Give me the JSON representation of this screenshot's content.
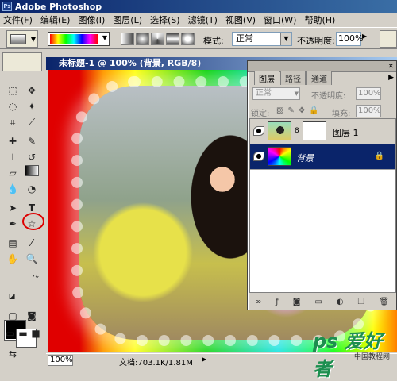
{
  "app": {
    "title": "Adobe Photoshop",
    "logo": "Ps"
  },
  "menu": [
    "文件(F)",
    "编辑(E)",
    "图像(I)",
    "图层(L)",
    "选择(S)",
    "滤镜(T)",
    "视图(V)",
    "窗口(W)",
    "帮助(H)"
  ],
  "options": {
    "mode_label": "模式:",
    "mode_value": "正常",
    "opacity_label": "不透明度:",
    "opacity_value": "100%"
  },
  "document": {
    "title": "未标题-1 @ 100% (背景, RGB/8)",
    "zoom": "100%",
    "doc_size": "文档:703.1K/1.81M"
  },
  "layers_panel": {
    "tabs": [
      "图层",
      "路径",
      "通道"
    ],
    "blend_mode": "正常",
    "opacity_label": "不透明度:",
    "opacity_value": "100%",
    "lock_label": "锁定:",
    "fill_label": "填充:",
    "fill_value": "100%",
    "layers": [
      {
        "name": "图层 1",
        "selected": false
      },
      {
        "name": "背景",
        "selected": true
      }
    ]
  },
  "watermark": {
    "main": "ps 爱好者",
    "sub": "中国教程网"
  }
}
